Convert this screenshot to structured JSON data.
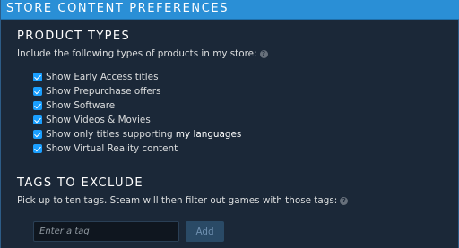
{
  "header": {
    "title": "STORE CONTENT PREFERENCES"
  },
  "product_types": {
    "title": "PRODUCT TYPES",
    "description": "Include the following types of products in my store:",
    "help_icon": "?",
    "options": [
      {
        "label": "Show Early Access titles",
        "checked": true
      },
      {
        "label": "Show Prepurchase offers",
        "checked": true
      },
      {
        "label": "Show Software",
        "checked": true
      },
      {
        "label": "Show Videos & Movies",
        "checked": true
      },
      {
        "label_prefix": "Show only titles supporting ",
        "label_strong": "my languages",
        "checked": true
      },
      {
        "label": "Show Virtual Reality content",
        "checked": true
      }
    ]
  },
  "tags_to_exclude": {
    "title": "TAGS TO EXCLUDE",
    "description": "Pick up to ten tags. Steam will then filter out games with those tags:",
    "help_icon": "?",
    "input_placeholder": "Enter a tag",
    "add_label": "Add"
  },
  "colors": {
    "background": "#1b2838",
    "header": "#2a8fd6",
    "checkbox": "#1a9fff",
    "button": "#2a4a66"
  },
  "icons": [
    "checkbox-checked-icon",
    "help-icon"
  ]
}
